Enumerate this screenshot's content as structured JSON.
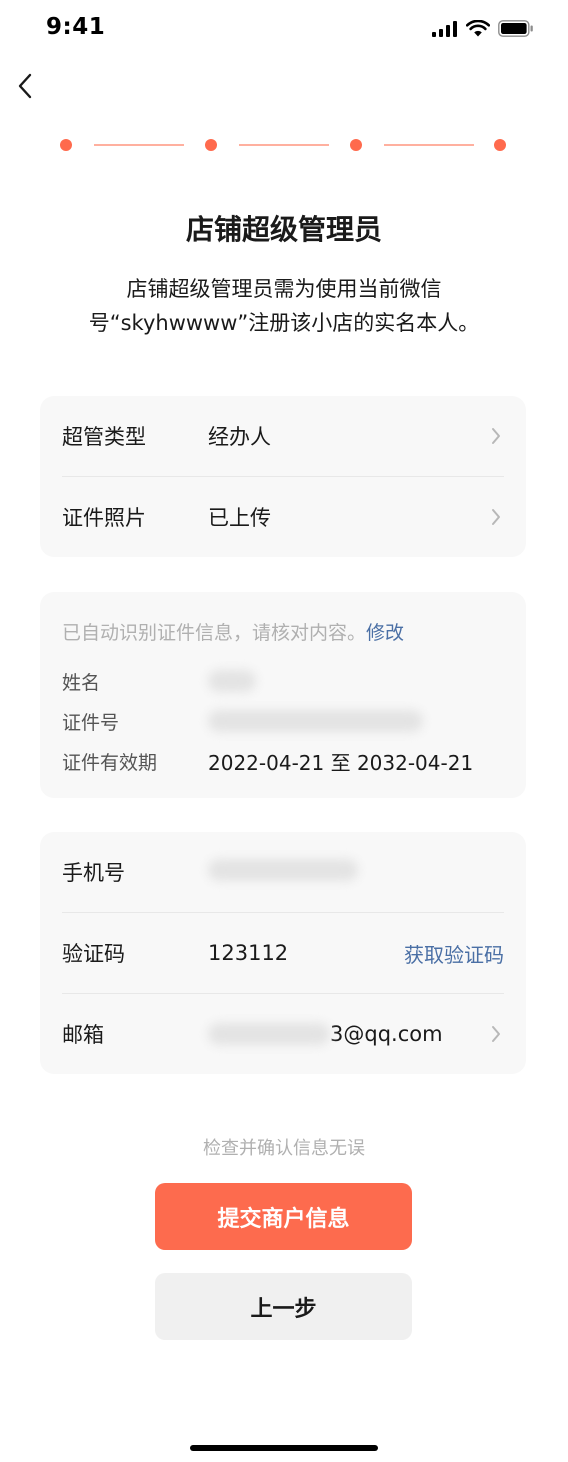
{
  "status_bar": {
    "time": "9:41"
  },
  "steps": {
    "count": 4,
    "current": 4,
    "accent": "#ff6a4d"
  },
  "header": {
    "title": "店铺超级管理员",
    "description": "店铺超级管理员需为使用当前微信号“skyhwwww”注册该小店的实名本人。"
  },
  "admin_card": {
    "type_label": "超管类型",
    "type_value": "经办人",
    "photo_label": "证件照片",
    "photo_value": "已上传"
  },
  "id_card": {
    "tip": "已自动识别证件信息，请核对内容。",
    "edit_link": "修改",
    "name_label": "姓名",
    "id_number_label": "证件号",
    "validity_label": "证件有效期",
    "validity_value": "2022-04-21 至 2032-04-21"
  },
  "contact_card": {
    "phone_label": "手机号",
    "code_label": "验证码",
    "code_value": "123112",
    "get_code_label": "获取验证码",
    "email_label": "邮箱",
    "email_visible_suffix": "3@qq.com"
  },
  "footer": {
    "hint": "检查并确认信息无误",
    "submit_label": "提交商户信息",
    "back_label": "上一步"
  },
  "colors": {
    "accent": "#fd6b4e",
    "link": "#4a6fa5"
  }
}
